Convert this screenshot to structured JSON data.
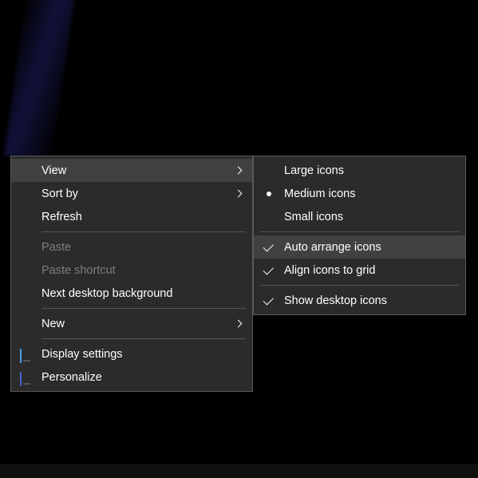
{
  "primary_menu": {
    "view": "View",
    "sort_by": "Sort by",
    "refresh": "Refresh",
    "paste": "Paste",
    "paste_shortcut": "Paste shortcut",
    "next_desktop_background": "Next desktop background",
    "new": "New",
    "display_settings": "Display settings",
    "personalize": "Personalize"
  },
  "view_submenu": {
    "large_icons": "Large icons",
    "medium_icons": "Medium icons",
    "small_icons": "Small icons",
    "auto_arrange": "Auto arrange icons",
    "align_to_grid": "Align icons to grid",
    "show_desktop_icons": "Show desktop icons",
    "selected_size": "medium",
    "auto_arrange_checked": true,
    "align_to_grid_checked": true,
    "show_desktop_icons_checked": true,
    "hovered_item": "auto_arrange"
  }
}
